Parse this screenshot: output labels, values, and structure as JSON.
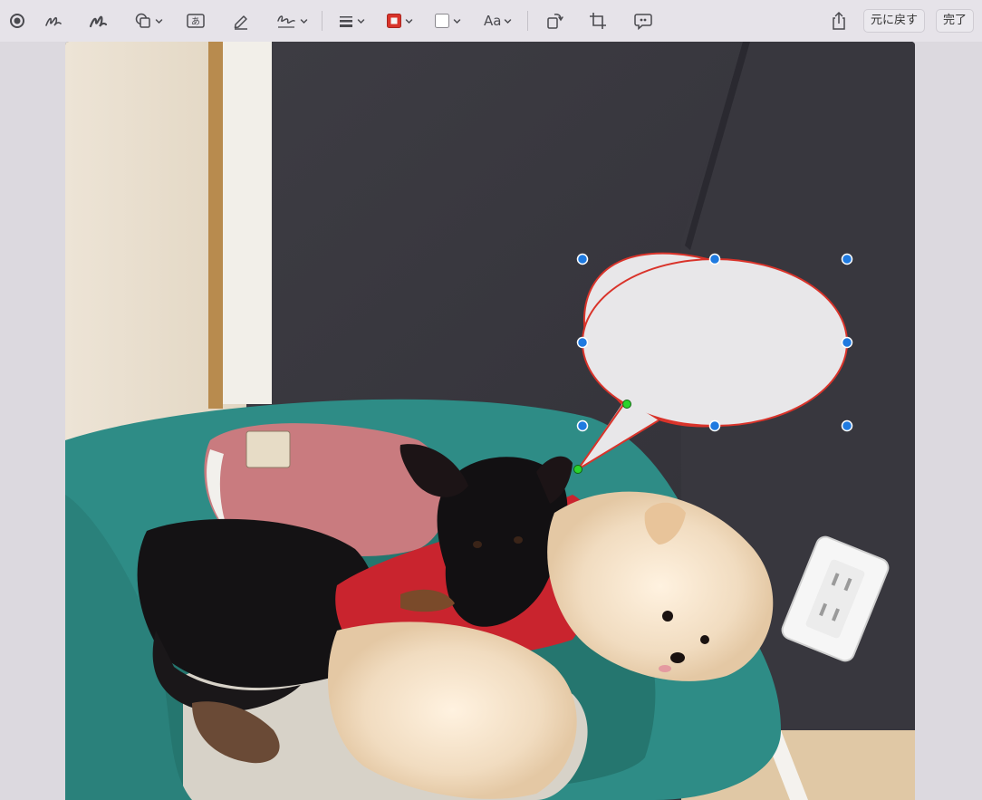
{
  "toolbar": {
    "undo_label": "元に戻す",
    "done_label": "完了",
    "text_style_label": "Aa",
    "text_tool_glyph": "あ"
  },
  "colors": {
    "border_color": "#d9332a",
    "selection_handle": "#1f7ae0",
    "tail_handle": "#2bd42b",
    "bubble_fill": "#e8e7e9"
  }
}
